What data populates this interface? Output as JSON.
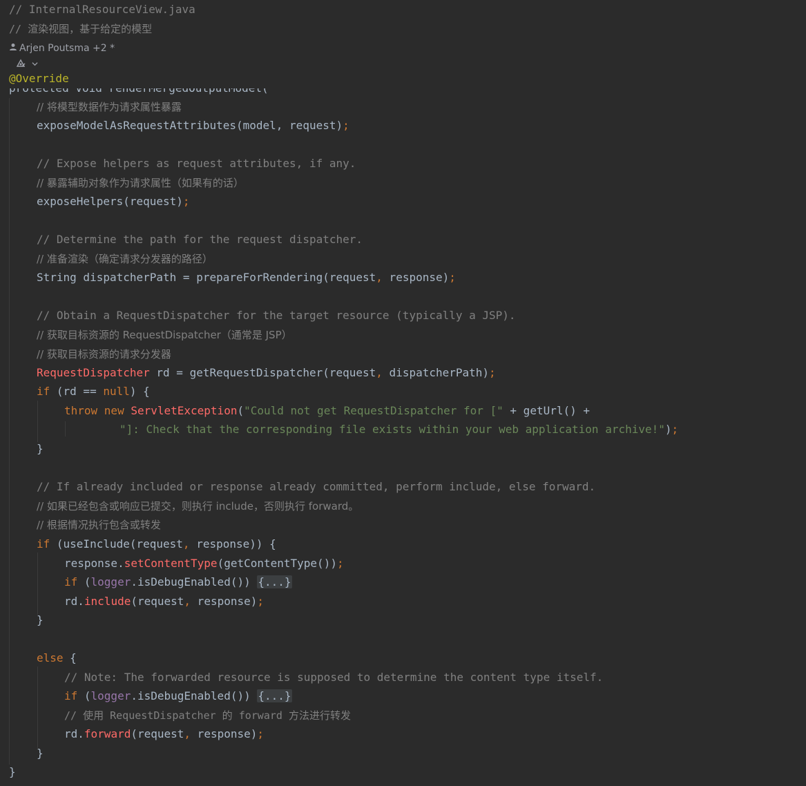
{
  "header": {
    "file_comment": "// InternalResourceView.java",
    "title_comment": "// 渲染视图，基于给定的模型",
    "authors": "Arjen Poutsma +2 *",
    "author_icon": "person-icon",
    "ai_icon": "ai-assistant-icon",
    "dropdown_icon": "chevron-down-icon",
    "annotation": "@Override",
    "partial_signature": "protected void renderMergedOutputModel("
  },
  "code": {
    "l1": "// 将模型数据作为请求属性暴露",
    "l2a": "exposeModelAsRequestAttributes(model, request)",
    "l2b": ";",
    "l3": "// Expose helpers as request attributes, if any.",
    "l4": "// 暴露辅助对象作为请求属性（如果有的话）",
    "l5a": "exposeHelpers(request)",
    "l5b": ";",
    "l6": "// Determine the path for the request dispatcher.",
    "l7": "// 准备渲染（确定请求分发器的路径）",
    "l8a": "String dispatcherPath = prepareForRendering(request",
    "l8b": ",",
    "l8c": " response)",
    "l8d": ";",
    "l9": "// Obtain a RequestDispatcher for the target resource (typically a JSP).",
    "l10": "// 获取目标资源的 RequestDispatcher（通常是 JSP）",
    "l11": "// 获取目标资源的请求分发器",
    "l12a": "RequestDispatcher",
    "l12b": " rd = getRequestDispatcher(request",
    "l12c": ",",
    "l12d": " dispatcherPath)",
    "l12e": ";",
    "l13a": "if",
    "l13b": " (rd == ",
    "l13c": "null",
    "l13d": ") {",
    "l14a": "throw new ",
    "l14b": "ServletException",
    "l14c": "(",
    "l14d": "\"Could not get RequestDispatcher for [\"",
    "l14e": " + getUrl() +",
    "l15a": "\"]: Check that the corresponding file exists within your web application archive!\"",
    "l15b": ")",
    "l15c": ";",
    "l16": "}",
    "l17": "// If already included or response already committed, perform include, else forward.",
    "l18": "// 如果已经包含或响应已提交，则执行 include，否则执行 forward。",
    "l19": "// 根据情况执行包含或转发",
    "l20a": "if",
    "l20b": " (useInclude(request",
    "l20c": ",",
    "l20d": " response)) {",
    "l21a": "response.",
    "l21b": "setContentType",
    "l21c": "(getContentType())",
    "l21d": ";",
    "l22a": "if",
    "l22b": " (",
    "l22c": "logger",
    "l22d": ".isDebugEnabled()) ",
    "l22e": "{...}",
    "l23a": "rd.",
    "l23b": "include",
    "l23c": "(request",
    "l23d": ",",
    "l23e": " response)",
    "l23f": ";",
    "l24": "}",
    "l25a": "else",
    "l25b": " {",
    "l26": "// Note: The forwarded resource is supposed to determine the content type itself.",
    "l27a": "if",
    "l27b": " (",
    "l27c": "logger",
    "l27d": ".isDebugEnabled()) ",
    "l27e": "{...}",
    "l28": "// 使用 RequestDispatcher 的 forward 方法进行转发",
    "l29a": "rd.",
    "l29b": "forward",
    "l29c": "(request",
    "l29d": ",",
    "l29e": " response)",
    "l29f": ";",
    "l30": "}",
    "l31": "}"
  }
}
